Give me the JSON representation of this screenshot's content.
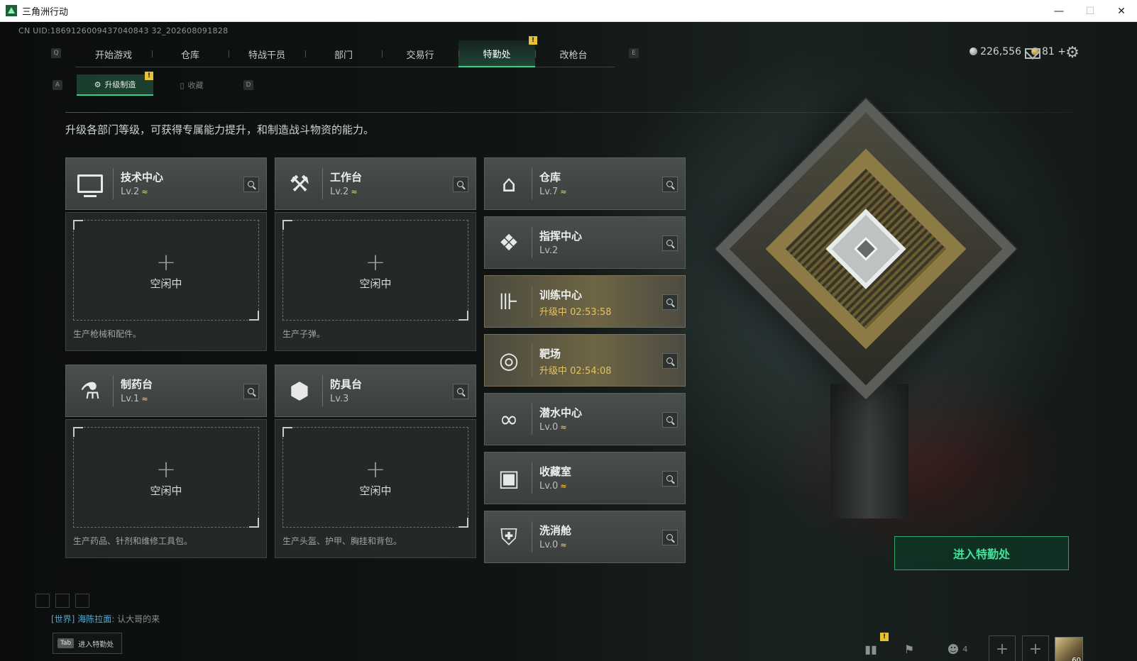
{
  "window": {
    "title": "三角洲行动",
    "controls": {
      "minimize": "—",
      "maximize": "☐",
      "close": "✕"
    }
  },
  "uid": "CN UID:1869126009437040843 32_202608091828",
  "topnav": {
    "key_left": "Q",
    "key_right": "E",
    "tabs": [
      {
        "label": "开始游戏"
      },
      {
        "label": "仓库"
      },
      {
        "label": "特战干员"
      },
      {
        "label": "部门"
      },
      {
        "label": "交易行"
      },
      {
        "label": "特勤处",
        "active": true,
        "badge": "!"
      },
      {
        "label": "改枪台"
      }
    ]
  },
  "subnav": {
    "key_left": "A",
    "key_right": "D",
    "tabs": [
      {
        "label": "升级制造",
        "active": true,
        "badge": "!"
      },
      {
        "label": "收藏"
      }
    ]
  },
  "resources": {
    "silver": "226,556",
    "gold": "81",
    "gold_add": "+"
  },
  "description": "升级各部门等级，可获得专属能力提升，和制造战斗物资的能力。",
  "production_departments": [
    {
      "name": "技术中心",
      "level": "Lv.2",
      "upgradable": true,
      "icon": "monitor-icon",
      "slot_plus": "+",
      "slot_status": "空闲中",
      "desc": "生产枪械和配件。"
    },
    {
      "name": "工作台",
      "level": "Lv.2",
      "upgradable": true,
      "icon": "tools-icon",
      "slot_plus": "+",
      "slot_status": "空闲中",
      "desc": "生产子弹。"
    },
    {
      "name": "制药台",
      "level": "Lv.1",
      "upgradable": true,
      "icon": "microscope-icon",
      "slot_plus": "+",
      "slot_status": "空闲中",
      "desc": "生产药品、针剂和维修工具包。"
    },
    {
      "name": "防具台",
      "level": "Lv.3",
      "upgradable": false,
      "icon": "armor-blocks-icon",
      "slot_plus": "+",
      "slot_status": "空闲中",
      "desc": "生产头盔、护甲、胸挂和背包。"
    }
  ],
  "other_departments": [
    {
      "name": "仓库",
      "level": "Lv.7",
      "upgradable": true,
      "icon": "warehouse-icon"
    },
    {
      "name": "指挥中心",
      "level": "Lv.2",
      "upgradable": false,
      "icon": "command-chip-icon"
    },
    {
      "name": "训练中心",
      "status": "升级中 02:53:58",
      "upgrading": true,
      "icon": "dumbbell-icon"
    },
    {
      "name": "靶场",
      "status": "升级中 02:54:08",
      "upgrading": true,
      "icon": "target-icon"
    },
    {
      "name": "潜水中心",
      "level": "Lv.0",
      "upgradable": true,
      "icon": "diving-mask-icon"
    },
    {
      "name": "收藏室",
      "level": "Lv.0",
      "upgradable": true,
      "icon": "display-case-icon"
    },
    {
      "name": "洗消舱",
      "level": "Lv.0",
      "upgradable": true,
      "icon": "decon-pod-icon"
    }
  ],
  "upgrade_mark": "≈",
  "enter_button": "进入特勤处",
  "chat": {
    "channel": "[世界]",
    "sender": "海陈拉面:",
    "message": "认大哥的来"
  },
  "tab_hint": {
    "key": "Tab",
    "label": "进入特勤处"
  },
  "bottom": {
    "friends_count": "4",
    "stats_badge": "!",
    "avatar_level": "60"
  }
}
